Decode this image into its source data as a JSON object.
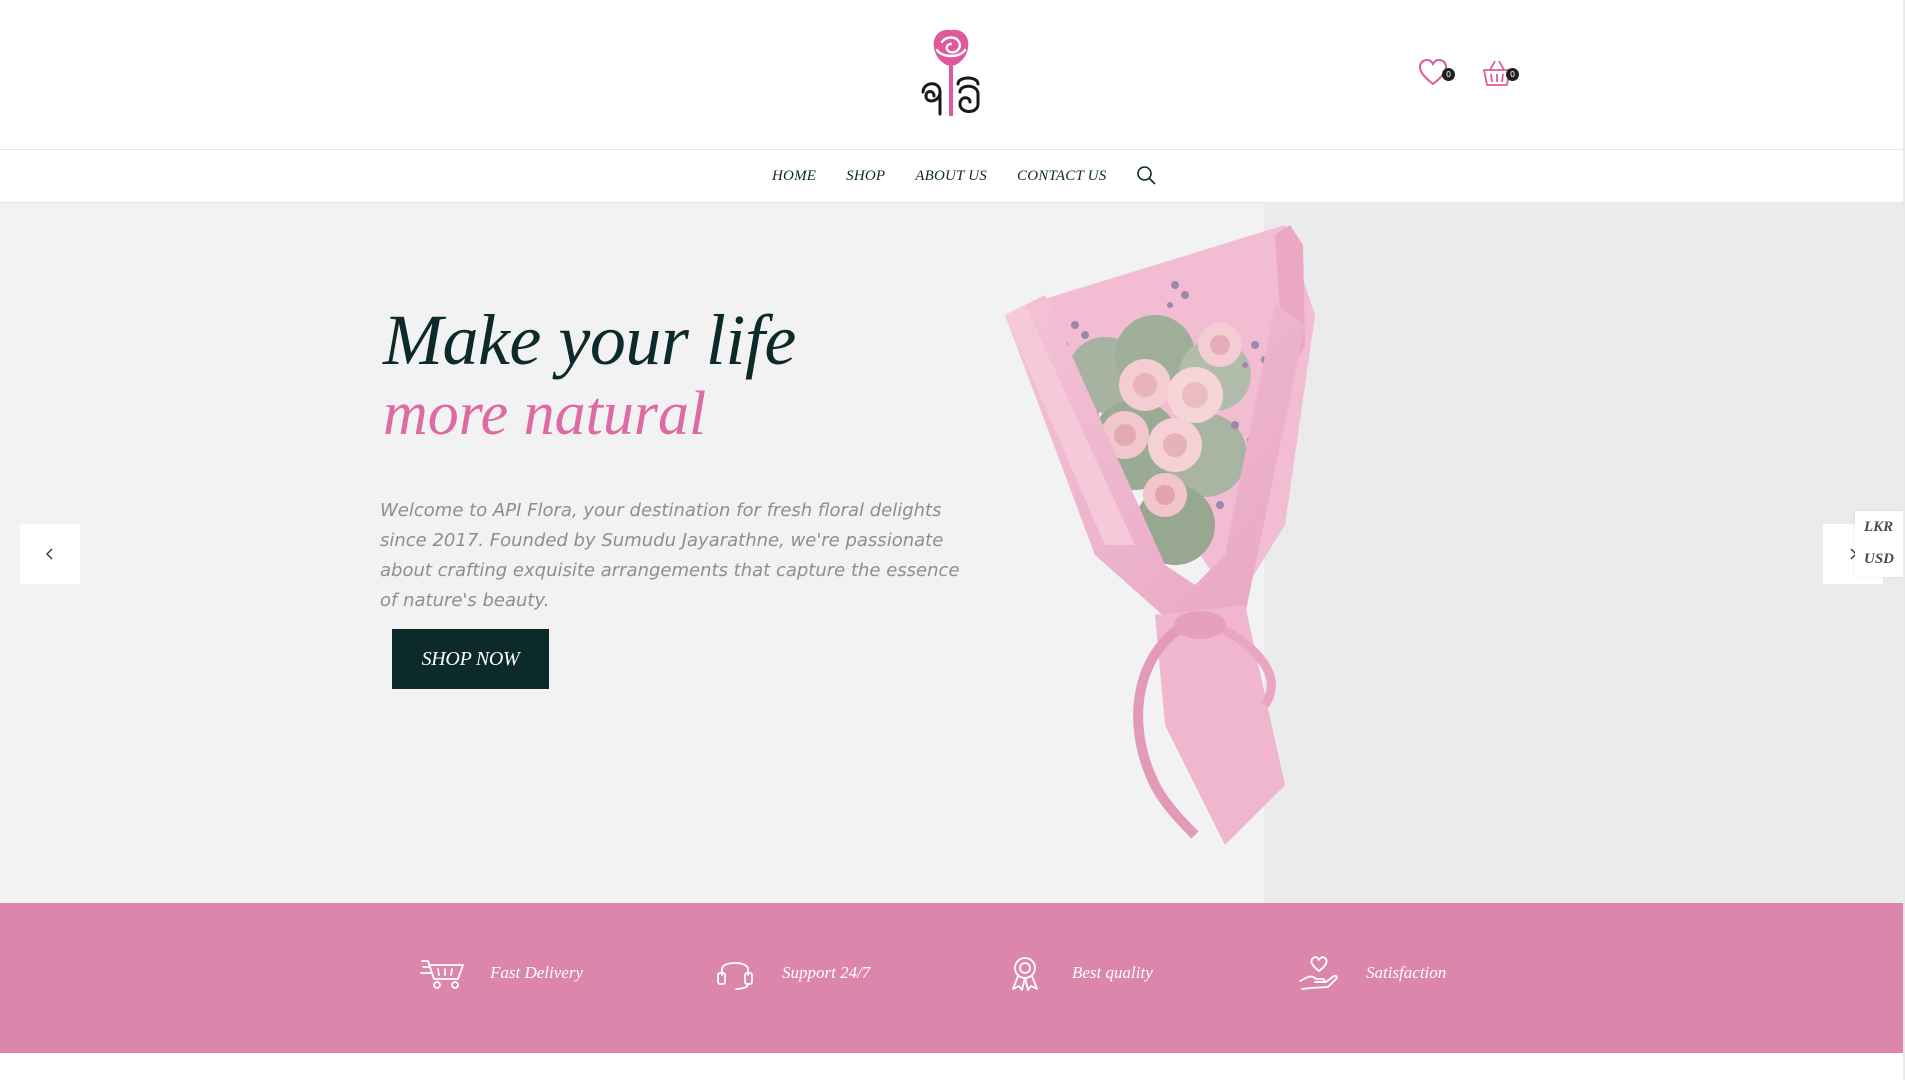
{
  "header": {
    "logo_alt": "API Flora",
    "wishlist_count": "0",
    "cart_count": "0"
  },
  "nav": {
    "items": [
      {
        "label": "HOME"
      },
      {
        "label": "SHOP"
      },
      {
        "label": "ABOUT US"
      },
      {
        "label": "CONTACT US"
      }
    ],
    "search_icon": "search-icon"
  },
  "hero": {
    "title_line1": "Make your life",
    "title_line2": "more natural",
    "description": "Welcome to API Flora, your destination for fresh floral delights since 2017. Founded by Sumudu Jayarathne, we're passionate about crafting exquisite arrangements that capture the essence of nature's beauty.",
    "button_label": "SHOP NOW"
  },
  "currency": {
    "options": [
      "LKR",
      "USD"
    ]
  },
  "features": [
    {
      "icon": "cart-icon",
      "label": "Fast Delivery"
    },
    {
      "icon": "headset-icon",
      "label": "Support 24/7"
    },
    {
      "icon": "award-icon",
      "label": "Best quality"
    },
    {
      "icon": "hand-heart-icon",
      "label": "Satisfaction"
    }
  ],
  "colors": {
    "accent_pink": "#de6aa3",
    "band_pink": "#dc86ab",
    "dark_teal": "#0c2a2a",
    "hero_bg": "#f2f2f2"
  }
}
